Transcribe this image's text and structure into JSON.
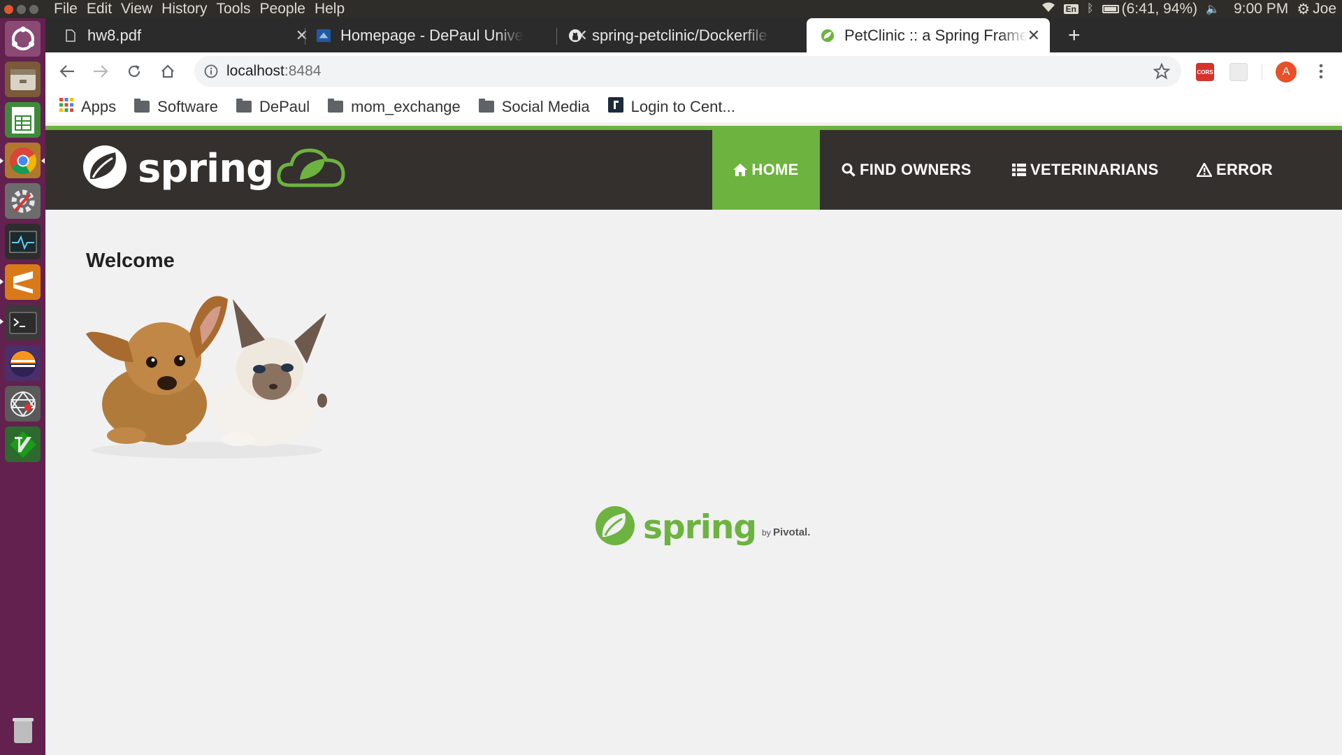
{
  "system": {
    "menu": [
      "File",
      "Edit",
      "View",
      "History",
      "Tools",
      "People",
      "Help"
    ],
    "keyboard": "En",
    "battery": "(6:41, 94%)",
    "clock": "9:00 PM",
    "user": "Joe"
  },
  "tabs": [
    {
      "title": "hw8.pdf",
      "icon": "file-icon"
    },
    {
      "title": "Homepage - DePaul University",
      "icon": "depaul-icon"
    },
    {
      "title": "spring-petclinic/Dockerfile",
      "icon": "github-icon"
    },
    {
      "title": "PetClinic :: a Spring Framework demonstration",
      "icon": "spring-leaf-icon",
      "active": true
    }
  ],
  "address": {
    "host": "localhost",
    "port": ":8484"
  },
  "profile_initial": "A",
  "cors_label": "CORS",
  "bookmarks": [
    {
      "label": "Apps",
      "icon": "apps-grid-icon"
    },
    {
      "label": "Software",
      "icon": "folder-icon"
    },
    {
      "label": "DePaul",
      "icon": "folder-icon"
    },
    {
      "label": "mom_exchange",
      "icon": "folder-icon"
    },
    {
      "label": "Social Media",
      "icon": "folder-icon"
    },
    {
      "label": "Login to Cent...",
      "icon": "site-favicon"
    }
  ],
  "site": {
    "brand": "spring",
    "nav": [
      {
        "label": "HOME",
        "icon": "home-icon",
        "active": true
      },
      {
        "label": "FIND OWNERS",
        "icon": "search-icon"
      },
      {
        "label": "VETERINARIANS",
        "icon": "list-icon"
      },
      {
        "label": "ERROR",
        "icon": "warning-icon"
      }
    ],
    "welcome": "Welcome",
    "footer_brand": "spring",
    "footer_by": "by",
    "footer_pivotal": "Pivotal."
  },
  "colors": {
    "spring_green": "#6db33f",
    "nav_bg": "#34302d",
    "launcher": "#63214f"
  }
}
